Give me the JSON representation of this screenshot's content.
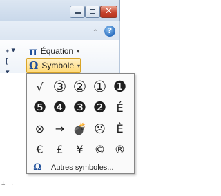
{
  "window": {
    "minimize_glyph": "",
    "maximize_glyph": "",
    "close_glyph": "✕"
  },
  "ribbon": {
    "collapse_caret": "⌃",
    "help_glyph": "?",
    "left_fragments": [
      "⁎ ▾",
      "⁅",
      "▾"
    ],
    "equation": {
      "symbol": "π",
      "label": "Équation",
      "arrow": "▾"
    },
    "symbole": {
      "symbol": "Ω",
      "label": "Symbole",
      "arrow": "▾"
    }
  },
  "ruler_fragment": "⊥ .",
  "symbols": [
    "√",
    "③",
    "②",
    "①",
    "❶",
    "❺",
    "❹",
    "❸",
    "❷",
    "É",
    "⊗",
    "→",
    "💣",
    "☹",
    "È",
    "€",
    "£",
    "¥",
    "©",
    "®"
  ],
  "more": {
    "symbol": "Ω",
    "label": "Autres symboles..."
  },
  "colors": {
    "accent": "#1f4f9a",
    "highlight": "#ffd977",
    "close": "#c7442d"
  }
}
